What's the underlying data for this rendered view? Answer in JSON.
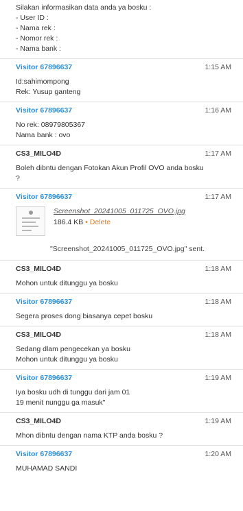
{
  "messages": [
    {
      "lines": [
        "Silakan informasikan data anda ya bosku :",
        "- User ID :",
        "- Nama rek :",
        "- Nomor rek :",
        "- Nama bank :"
      ]
    },
    {
      "sender": "Visitor 67896637",
      "time": "1:15 AM",
      "lines": [
        "Id:sahimompong",
        "Rek: Yusup ganteng"
      ]
    },
    {
      "sender": "Visitor 67896637",
      "time": "1:16 AM",
      "lines": [
        "No rek: 08979805367",
        "Nama bank : ovo"
      ]
    },
    {
      "sender": "CS3_MILO4D",
      "time": "1:17 AM",
      "lines": [
        "Boleh dibntu dengan Fotokan Akun Profil OVO anda bosku",
        "?"
      ]
    },
    {
      "sender": "Visitor 67896637",
      "time": "1:17 AM",
      "attachment": {
        "filename": "Screenshot_20241005_011725_OVO.jpg",
        "size": "186.4 KB",
        "separator": "•",
        "delete_label": "Delete",
        "status": "\"Screenshot_20241005_011725_OVO.jpg\" sent."
      }
    },
    {
      "sender": "CS3_MILO4D",
      "time": "1:18 AM",
      "lines": [
        "Mohon untuk ditunggu ya bosku"
      ]
    },
    {
      "sender": "Visitor 67896637",
      "time": "1:18 AM",
      "lines": [
        "Segera proses dong biasanya cepet bosku"
      ]
    },
    {
      "sender": "CS3_MILO4D",
      "time": "1:18 AM",
      "lines": [
        "Sedang dlam pengecekan ya bosku",
        "Mohon untuk ditunggu ya bosku"
      ]
    },
    {
      "sender": "Visitor 67896637",
      "time": "1:19 AM",
      "lines": [
        "Iya bosku udh di tunggu dari jam 01",
        "19 menit nunggu ga masuk\""
      ]
    },
    {
      "sender": "CS3_MILO4D",
      "time": "1:19 AM",
      "lines": [
        "Mhon dibntu dengan nama KTP anda bosku ?"
      ]
    },
    {
      "sender": "Visitor 67896637",
      "time": "1:20 AM",
      "lines": [
        "MUHAMAD SANDI"
      ]
    }
  ],
  "colors": {
    "visitor": "#2d8fd5",
    "agent": "#333333",
    "delete": "#e07a1f",
    "divider": "#e2e2e2"
  },
  "icons": {
    "attachment_thumbnail": "image-thumbnail-icon"
  }
}
